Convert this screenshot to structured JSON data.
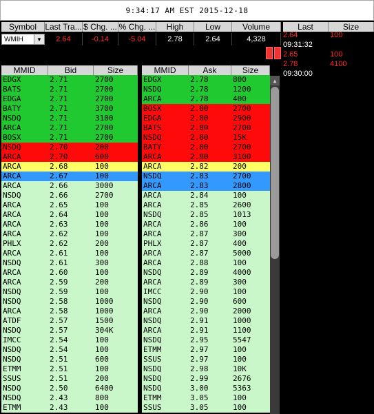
{
  "title": "9:34:17 AM EST 2015-12-18",
  "quote_headers": [
    "Symbol",
    "Last Tra...",
    "$ Chg. ...",
    "% Chg. ...",
    "High",
    "Low",
    "Volume"
  ],
  "quote": {
    "symbol": "WMIH",
    "last": "2.64",
    "chg": "-0.14",
    "pct": "-5.04",
    "high": "2.78",
    "low": "2.64",
    "volume": "4,328"
  },
  "ts_headers": [
    "Last",
    "Size"
  ],
  "time_and_sales": [
    {
      "price": "2.64",
      "size": "100"
    },
    {
      "time": "09:31:32"
    },
    {
      "price": "2.65",
      "size": "100"
    },
    {
      "price": "2.78",
      "size": "4100"
    },
    {
      "time": "09:30:00"
    }
  ],
  "bid_headers": [
    "MMID",
    "Bid",
    "Size"
  ],
  "ask_headers": [
    "MMID",
    "Ask",
    "Size"
  ],
  "colors": {
    "green": "#1fc92f",
    "red": "#ff0a0a",
    "yellow": "#ffff66",
    "blue": "#3399ff",
    "light": "#c9f7c9"
  },
  "bids": [
    {
      "mmid": "EDGX",
      "price": "2.71",
      "size": "2700",
      "c": "green"
    },
    {
      "mmid": "BATS",
      "price": "2.71",
      "size": "2700",
      "c": "green"
    },
    {
      "mmid": "EDGA",
      "price": "2.71",
      "size": "2700",
      "c": "green"
    },
    {
      "mmid": "BATY",
      "price": "2.71",
      "size": "3700",
      "c": "green"
    },
    {
      "mmid": "NSDQ",
      "price": "2.71",
      "size": "3100",
      "c": "green"
    },
    {
      "mmid": "ARCA",
      "price": "2.71",
      "size": "2700",
      "c": "green"
    },
    {
      "mmid": "BOSX",
      "price": "2.71",
      "size": "2700",
      "c": "green"
    },
    {
      "mmid": "NSDQ",
      "price": "2.70",
      "size": "200",
      "c": "red"
    },
    {
      "mmid": "ARCA",
      "price": "2.70",
      "size": "600",
      "c": "red"
    },
    {
      "mmid": "ARCA",
      "price": "2.68",
      "size": "100",
      "c": "yellow"
    },
    {
      "mmid": "ARCA",
      "price": "2.67",
      "size": "100",
      "c": "blue"
    },
    {
      "mmid": "ARCA",
      "price": "2.66",
      "size": "3000",
      "c": "light"
    },
    {
      "mmid": "NSDQ",
      "price": "2.66",
      "size": "2700",
      "c": "light"
    },
    {
      "mmid": "ARCA",
      "price": "2.65",
      "size": "100",
      "c": "light"
    },
    {
      "mmid": "ARCA",
      "price": "2.64",
      "size": "100",
      "c": "light"
    },
    {
      "mmid": "ARCA",
      "price": "2.63",
      "size": "100",
      "c": "light"
    },
    {
      "mmid": "ARCA",
      "price": "2.62",
      "size": "100",
      "c": "light"
    },
    {
      "mmid": "PHLX",
      "price": "2.62",
      "size": "200",
      "c": "light"
    },
    {
      "mmid": "ARCA",
      "price": "2.61",
      "size": "100",
      "c": "light"
    },
    {
      "mmid": "NSDQ",
      "price": "2.61",
      "size": "300",
      "c": "light"
    },
    {
      "mmid": "ARCA",
      "price": "2.60",
      "size": "100",
      "c": "light"
    },
    {
      "mmid": "ARCA",
      "price": "2.59",
      "size": "200",
      "c": "light"
    },
    {
      "mmid": "NSDQ",
      "price": "2.59",
      "size": "100",
      "c": "light"
    },
    {
      "mmid": "NSDQ",
      "price": "2.58",
      "size": "1000",
      "c": "light"
    },
    {
      "mmid": "ARCA",
      "price": "2.58",
      "size": "1000",
      "c": "light"
    },
    {
      "mmid": "ATDF",
      "price": "2.57",
      "size": "1500",
      "c": "light"
    },
    {
      "mmid": "NSDQ",
      "price": "2.57",
      "size": "304K",
      "c": "light"
    },
    {
      "mmid": "IMCC",
      "price": "2.54",
      "size": "100",
      "c": "light"
    },
    {
      "mmid": "NSDQ",
      "price": "2.54",
      "size": "100",
      "c": "light"
    },
    {
      "mmid": "NSDQ",
      "price": "2.51",
      "size": "600",
      "c": "light"
    },
    {
      "mmid": "ETMM",
      "price": "2.51",
      "size": "100",
      "c": "light"
    },
    {
      "mmid": "SSUS",
      "price": "2.51",
      "size": "200",
      "c": "light"
    },
    {
      "mmid": "NSDQ",
      "price": "2.50",
      "size": "6400",
      "c": "light"
    },
    {
      "mmid": "NSDQ",
      "price": "2.43",
      "size": "800",
      "c": "light"
    },
    {
      "mmid": "ETMM",
      "price": "2.43",
      "size": "100",
      "c": "light"
    }
  ],
  "asks": [
    {
      "mmid": "EDGX",
      "price": "2.78",
      "size": "800",
      "c": "green"
    },
    {
      "mmid": "NSDQ",
      "price": "2.78",
      "size": "1200",
      "c": "green"
    },
    {
      "mmid": "ARCA",
      "price": "2.78",
      "size": "400",
      "c": "green"
    },
    {
      "mmid": "BOSX",
      "price": "2.80",
      "size": "2700",
      "c": "red"
    },
    {
      "mmid": "EDGA",
      "price": "2.80",
      "size": "2900",
      "c": "red"
    },
    {
      "mmid": "BATS",
      "price": "2.80",
      "size": "2700",
      "c": "red"
    },
    {
      "mmid": "NSDQ",
      "price": "2.80",
      "size": "15K",
      "c": "red"
    },
    {
      "mmid": "BATY",
      "price": "2.80",
      "size": "2700",
      "c": "red"
    },
    {
      "mmid": "ARCA",
      "price": "2.80",
      "size": "3100",
      "c": "red"
    },
    {
      "mmid": "ARCA",
      "price": "2.82",
      "size": "200",
      "c": "yellow"
    },
    {
      "mmid": "NSDQ",
      "price": "2.83",
      "size": "2700",
      "c": "blue"
    },
    {
      "mmid": "ARCA",
      "price": "2.83",
      "size": "2800",
      "c": "blue"
    },
    {
      "mmid": "ARCA",
      "price": "2.84",
      "size": "100",
      "c": "light"
    },
    {
      "mmid": "ARCA",
      "price": "2.85",
      "size": "2600",
      "c": "light"
    },
    {
      "mmid": "NSDQ",
      "price": "2.85",
      "size": "1013",
      "c": "light"
    },
    {
      "mmid": "ARCA",
      "price": "2.86",
      "size": "100",
      "c": "light"
    },
    {
      "mmid": "ARCA",
      "price": "2.87",
      "size": "300",
      "c": "light"
    },
    {
      "mmid": "PHLX",
      "price": "2.87",
      "size": "400",
      "c": "light"
    },
    {
      "mmid": "ARCA",
      "price": "2.87",
      "size": "5000",
      "c": "light"
    },
    {
      "mmid": "ARCA",
      "price": "2.88",
      "size": "100",
      "c": "light"
    },
    {
      "mmid": "NSDQ",
      "price": "2.89",
      "size": "4000",
      "c": "light"
    },
    {
      "mmid": "ARCA",
      "price": "2.89",
      "size": "300",
      "c": "light"
    },
    {
      "mmid": "IMCC",
      "price": "2.90",
      "size": "100",
      "c": "light"
    },
    {
      "mmid": "NSDQ",
      "price": "2.90",
      "size": "600",
      "c": "light"
    },
    {
      "mmid": "ARCA",
      "price": "2.90",
      "size": "2000",
      "c": "light"
    },
    {
      "mmid": "NSDQ",
      "price": "2.91",
      "size": "1000",
      "c": "light"
    },
    {
      "mmid": "ARCA",
      "price": "2.91",
      "size": "1100",
      "c": "light"
    },
    {
      "mmid": "NSDQ",
      "price": "2.95",
      "size": "5547",
      "c": "light"
    },
    {
      "mmid": "ETMM",
      "price": "2.97",
      "size": "100",
      "c": "light"
    },
    {
      "mmid": "SSUS",
      "price": "2.97",
      "size": "100",
      "c": "light"
    },
    {
      "mmid": "NSDQ",
      "price": "2.98",
      "size": "10K",
      "c": "light"
    },
    {
      "mmid": "NSDQ",
      "price": "2.99",
      "size": "2676",
      "c": "light"
    },
    {
      "mmid": "NSDQ",
      "price": "3.00",
      "size": "5363",
      "c": "light"
    },
    {
      "mmid": "ETMM",
      "price": "3.05",
      "size": "100",
      "c": "light"
    },
    {
      "mmid": "SSUS",
      "price": "3.05",
      "size": "100",
      "c": "light"
    }
  ]
}
